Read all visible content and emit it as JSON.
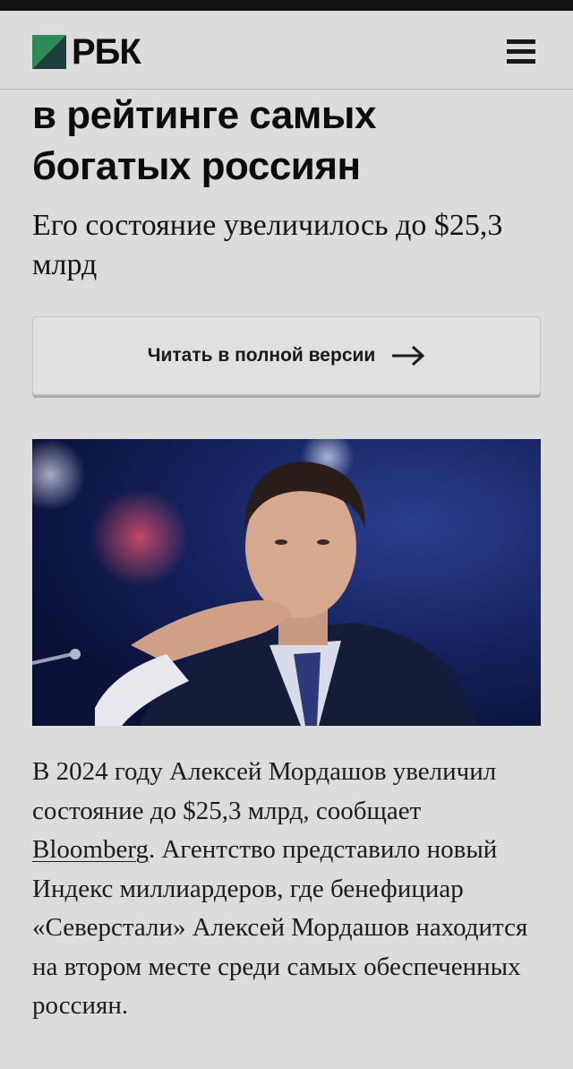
{
  "header": {
    "logo_text": "РБК",
    "logo_icon": "rbc-logo-mark",
    "menu_icon": "hamburger-menu-icon",
    "background": "#dcdcdc"
  },
  "article": {
    "headline_line1": "в рейтинге самых",
    "headline_line2": "богатых россиян",
    "subtitle": "Его состояние увеличилось до $25,3 млрд",
    "read_full_label": "Читать в полной версии",
    "photo": "portrait-of-aleksey-mordashov",
    "body_before_link": "В 2024 году Алексей Мордашов увеличил состояние до $25,3 млрд, сообщает ",
    "body_link": "Bloomberg",
    "body_after_link": ". Агентство представило новый Индекс миллиардеров, где бенефициар «Северстали» Алексей Мордашов находится на втором месте среди самых обеспеченных россиян."
  },
  "colors": {
    "logo_green": "#2e8b57",
    "logo_dark": "#1f3d3b",
    "photo_background": "#0c1744"
  }
}
